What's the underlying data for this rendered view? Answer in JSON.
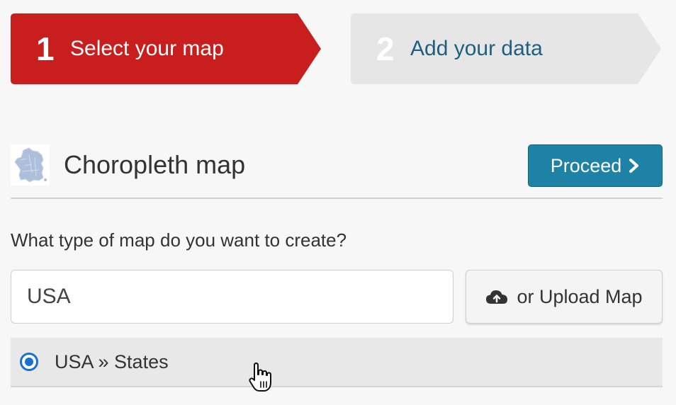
{
  "steps": [
    {
      "number": "1",
      "label": "Select your map",
      "active": true
    },
    {
      "number": "2",
      "label": "Add your data",
      "active": false
    }
  ],
  "map": {
    "title": "Choropleth map",
    "thumbnail_icon": "france-map-thumbnail"
  },
  "proceed": {
    "label": "Proceed",
    "icon": "chevron-right-icon"
  },
  "question": "What type of map do you want to create?",
  "search": {
    "value": "USA"
  },
  "upload": {
    "label": "or Upload Map",
    "icon": "cloud-upload-icon"
  },
  "options": [
    {
      "label": "USA » States",
      "selected": true
    }
  ],
  "colors": {
    "active_step": "#c81e1e",
    "inactive_step": "#e6e6e6",
    "primary_button": "#1d82a6",
    "radio": "#1a6fd3"
  }
}
